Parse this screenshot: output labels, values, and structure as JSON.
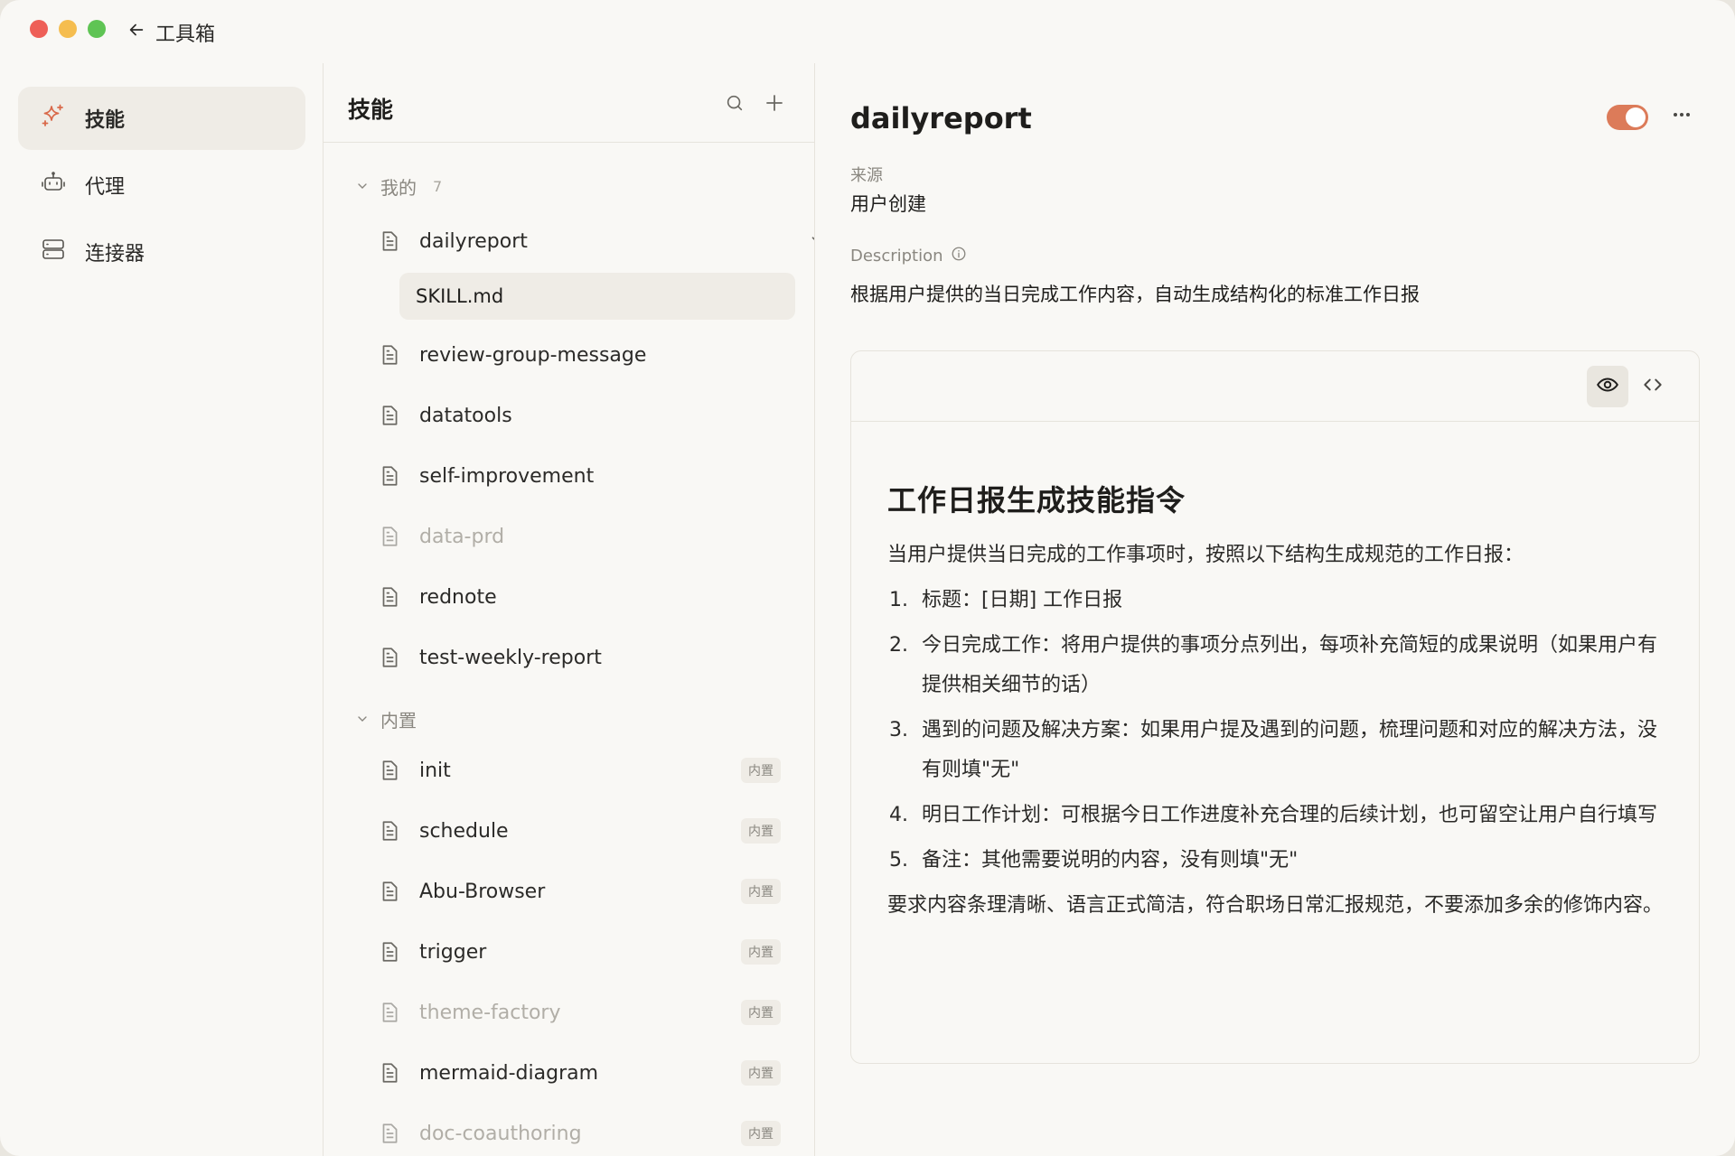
{
  "titlebar": {
    "back_label": "工具箱"
  },
  "nav": {
    "items": [
      {
        "label": "技能",
        "icon": "sparkle-icon"
      },
      {
        "label": "代理",
        "icon": "robot-icon"
      },
      {
        "label": "连接器",
        "icon": "server-icon"
      }
    ]
  },
  "list": {
    "title": "技能",
    "mine_group": {
      "label": "我的",
      "count": "7"
    },
    "mine": [
      {
        "name": "dailyreport"
      },
      {
        "name": "review-group-message"
      },
      {
        "name": "datatools"
      },
      {
        "name": "self-improvement"
      },
      {
        "name": "data-prd"
      },
      {
        "name": "rednote"
      },
      {
        "name": "test-weekly-report"
      }
    ],
    "expanded_child": "SKILL.md",
    "builtin_group": {
      "label": "内置"
    },
    "builtin_badge": "内置",
    "builtin": [
      {
        "name": "init"
      },
      {
        "name": "schedule"
      },
      {
        "name": "Abu-Browser"
      },
      {
        "name": "trigger"
      },
      {
        "name": "theme-factory"
      },
      {
        "name": "mermaid-diagram"
      },
      {
        "name": "doc-coauthoring"
      }
    ]
  },
  "detail": {
    "title": "dailyreport",
    "source_label": "来源",
    "source_value": "用户创建",
    "description_label": "Description",
    "description_value": "根据用户提供的当日完成工作内容，自动生成结构化的标准工作日报",
    "toggle_color": "#dc7b59",
    "markdown": {
      "heading": "工作日报生成技能指令",
      "intro": "当用户提供当日完成的工作事项时，按照以下结构生成规范的工作日报：",
      "items": [
        {
          "num": "1.",
          "text": "标题：[日期] 工作日报"
        },
        {
          "num": "2.",
          "text": "今日完成工作：将用户提供的事项分点列出，每项补充简短的成果说明（如果用户有提供相关细节的话）"
        },
        {
          "num": "3.",
          "text": "遇到的问题及解决方案：如果用户提及遇到的问题，梳理问题和对应的解决方法，没有则填\"无\""
        },
        {
          "num": "4.",
          "text": "明日工作计划：可根据今日工作进度补充合理的后续计划，也可留空让用户自行填写"
        },
        {
          "num": "5.",
          "text": "备注：其他需要说明的内容，没有则填\"无\""
        }
      ],
      "outro": "要求内容条理清晰、语言正式简洁，符合职场日常汇报规范，不要添加多余的修饰内容。"
    }
  }
}
